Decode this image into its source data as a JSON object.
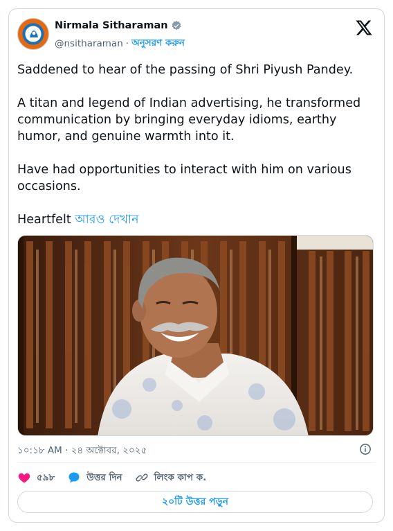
{
  "author": {
    "name": "Nirmala Sitharaman",
    "handle": "@nsitharaman",
    "separator": "·",
    "follow_label": "অনুসরণ করুন"
  },
  "tweet": {
    "paragraphs": [
      "Saddened to hear of the passing of Shri Piyush Pandey.",
      "A titan and legend of Indian advertising, he transformed communication by bringing everyday idioms, earthy humor, and genuine warmth into it.",
      "Have had opportunities to interact with him on various occasions."
    ],
    "truncated_text": "Heartfelt",
    "show_more_label": "আরও দেখান"
  },
  "timestamp": "১০:১৮ AM · ২৪ অক্টোবর, ২০২৫",
  "actions": {
    "like_count": "৫৯৮",
    "reply_label": "উত্তর দিন",
    "copy_link_label": "লিংক কাপ ক."
  },
  "replies_button_label": "২০টি উত্তর পড়ুন",
  "icons": {
    "brand": "x-logo-icon",
    "verified": "verified-badge-icon",
    "info": "info-icon",
    "like": "heart-icon",
    "reply": "speech-bubble-icon",
    "copy_link": "link-icon"
  },
  "colors": {
    "accent": "#1d9bf0",
    "like": "#f91880",
    "text": "#0f1419",
    "secondary": "#536471"
  }
}
